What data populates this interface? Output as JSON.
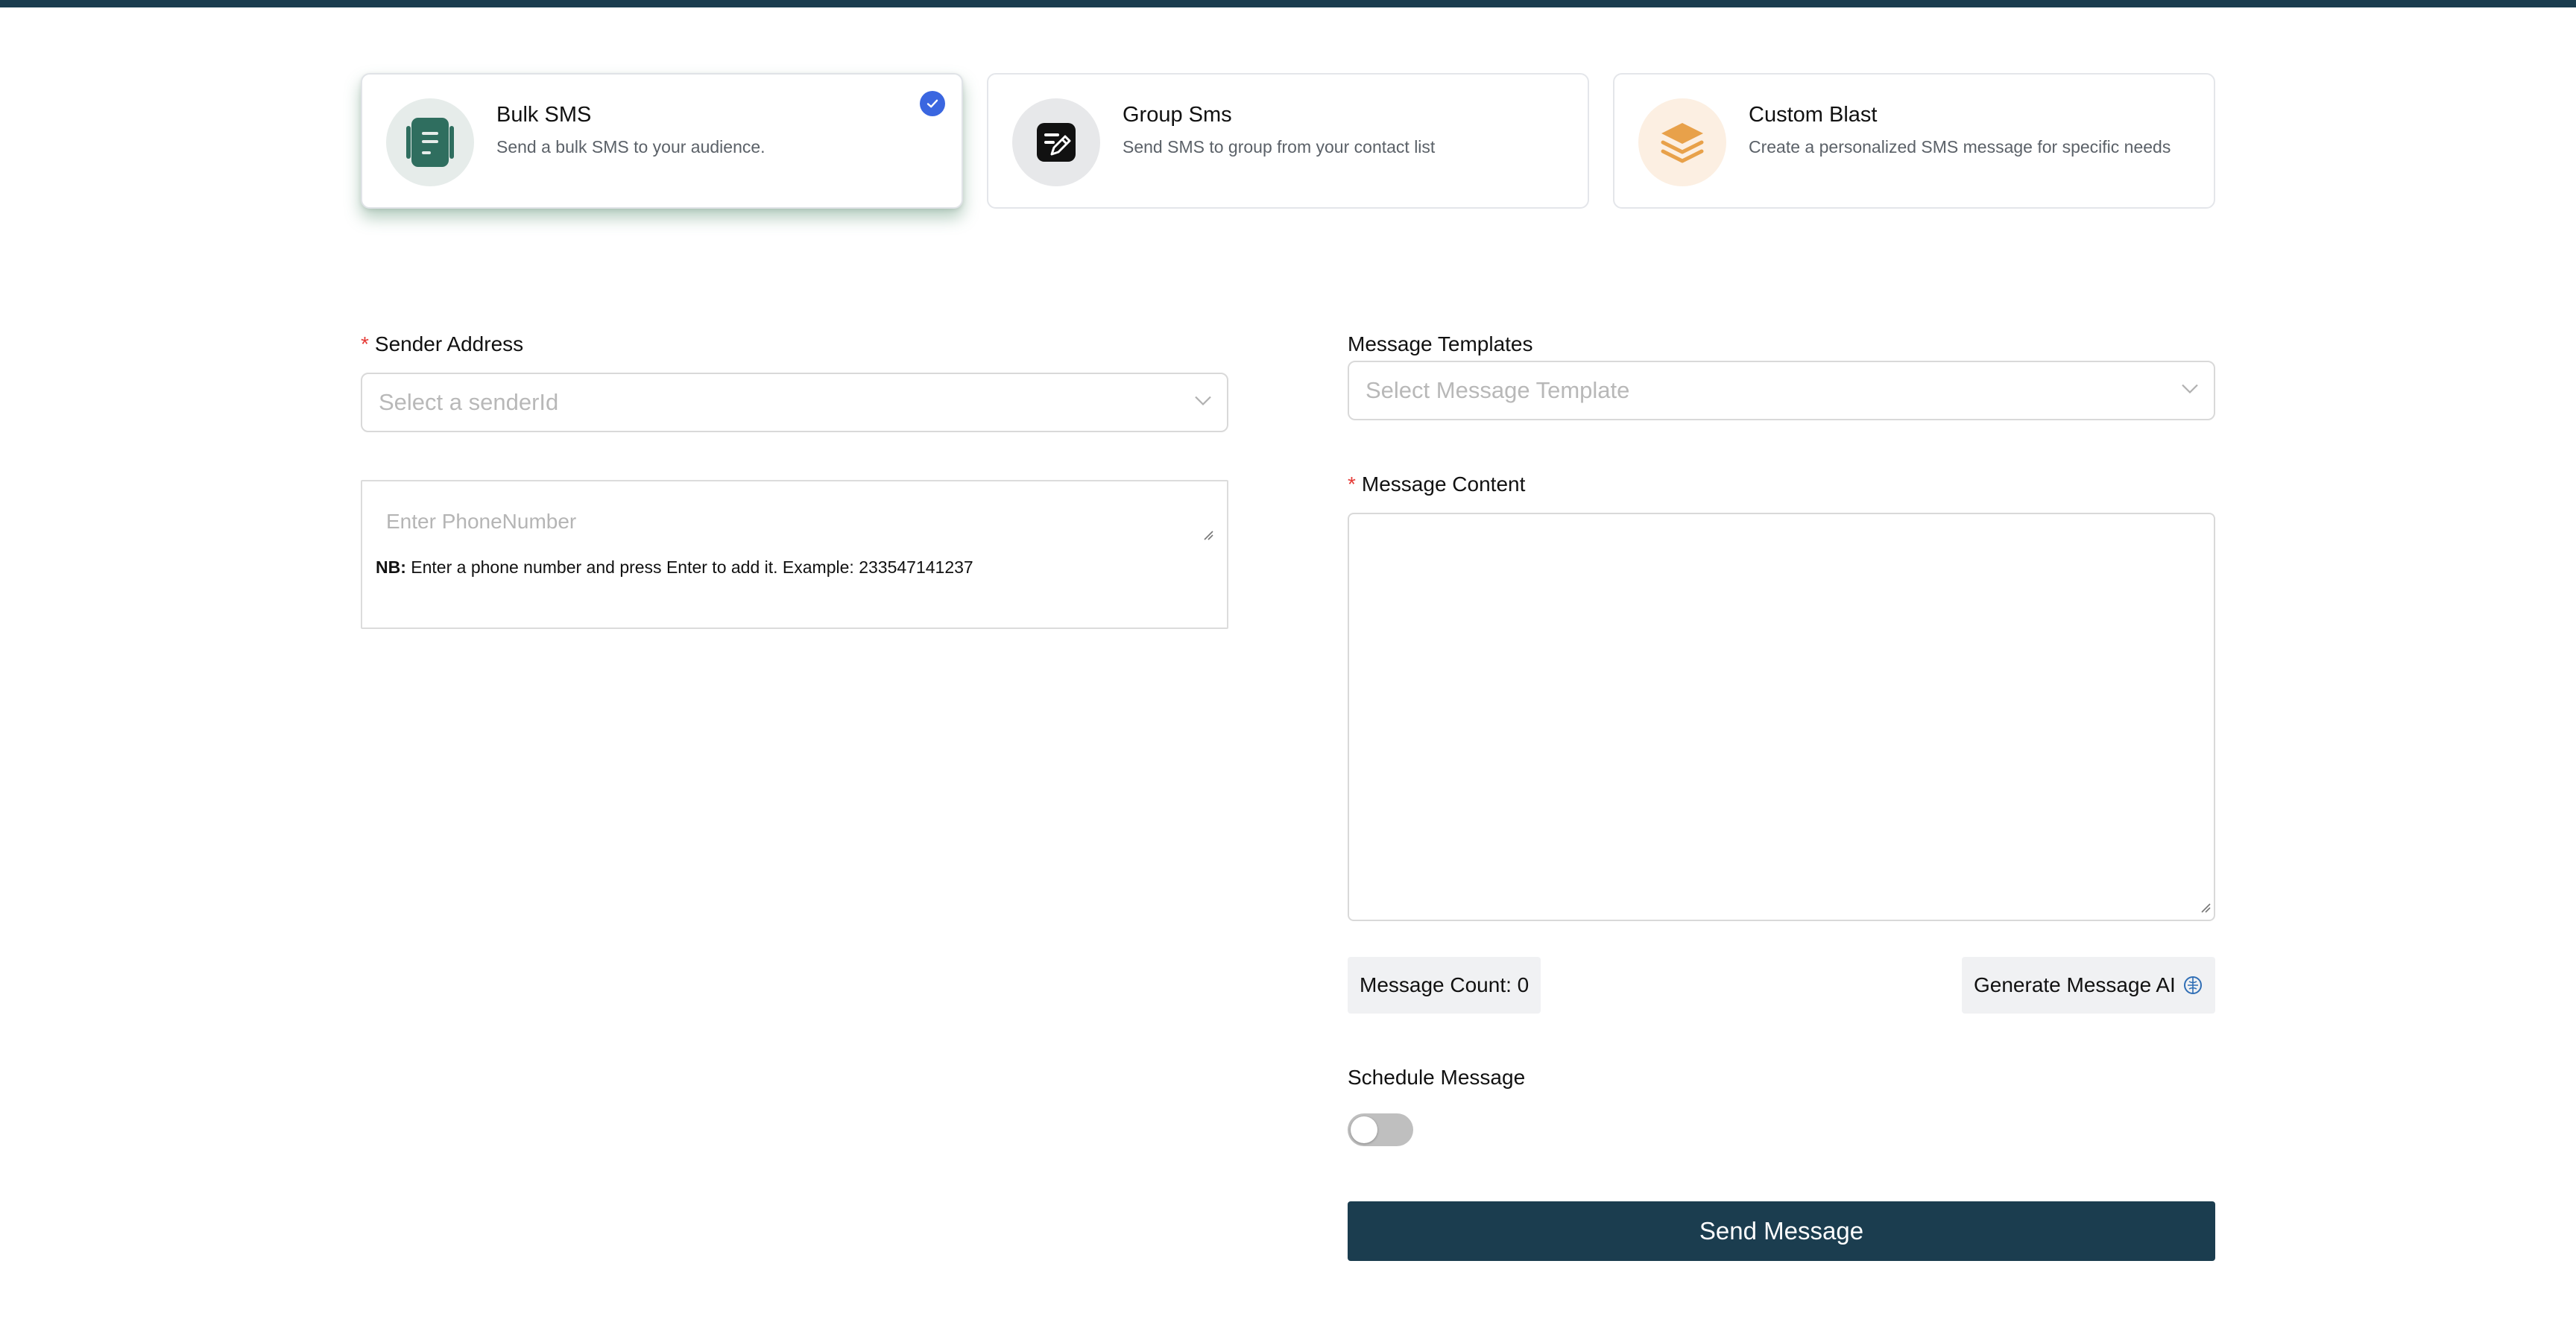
{
  "colors": {
    "brand": "#1b3d4f",
    "check_badge": "#3a66e0",
    "required": "#e53935",
    "bulk_icon": "#2f6e5f",
    "custom_icon": "#e8a14a"
  },
  "sms_types": [
    {
      "title": "Bulk SMS",
      "description": "Send a bulk SMS to your audience.",
      "icon": "document-icon",
      "selected": true
    },
    {
      "title": "Group Sms",
      "description": "Send SMS to group from your contact list",
      "icon": "edit-note-icon",
      "selected": false
    },
    {
      "title": "Custom Blast",
      "description": "Create a personalized SMS message for specific needs",
      "icon": "layers-icon",
      "selected": false
    }
  ],
  "sender": {
    "required_mark": "*",
    "label": "Sender Address",
    "placeholder": "Select a senderId"
  },
  "phone": {
    "placeholder": "Enter PhoneNumber",
    "note_prefix": "NB:",
    "note_text": " Enter a phone number and press Enter to add it. Example: 233547141237"
  },
  "templates": {
    "label": "Message Templates",
    "placeholder": "Select Message Template"
  },
  "content": {
    "required_mark": "*",
    "label": "Message Content",
    "value": ""
  },
  "message_count": {
    "label": "Message Count: 0"
  },
  "generate_ai": {
    "label": "Generate Message AI",
    "icon": "ai-brain-icon"
  },
  "schedule": {
    "label": "Schedule Message",
    "enabled": false
  },
  "send_button": {
    "label": "Send Message"
  }
}
